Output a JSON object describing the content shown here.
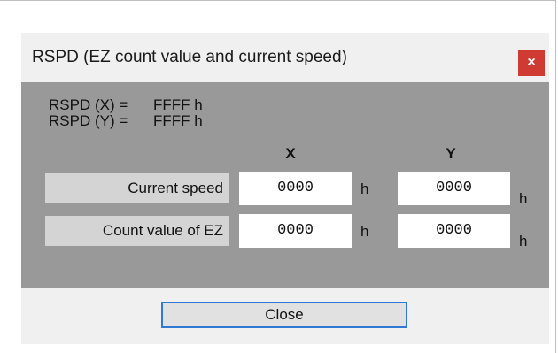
{
  "dialog": {
    "title": "RSPD (EZ count value and current speed)",
    "close_x": "×"
  },
  "status": {
    "lines": [
      {
        "key": "RSPD (X) =",
        "value": "FFFF h"
      },
      {
        "key": "RSPD (Y) =",
        "value": "FFFF h"
      }
    ]
  },
  "table": {
    "col_x": "X",
    "col_y": "Y",
    "rows": [
      {
        "label": "Current speed",
        "x": "0000",
        "x_unit": "h",
        "y": "0000",
        "y_unit": "h"
      },
      {
        "label": "Count value of EZ",
        "x": "0000",
        "x_unit": "h",
        "y": "0000",
        "y_unit": "h"
      }
    ]
  },
  "footer": {
    "close_label": "Close"
  },
  "colors": {
    "panel_bg": "#999999",
    "close_x_bg": "#cf3a33",
    "focus_border": "#2f79d4"
  }
}
